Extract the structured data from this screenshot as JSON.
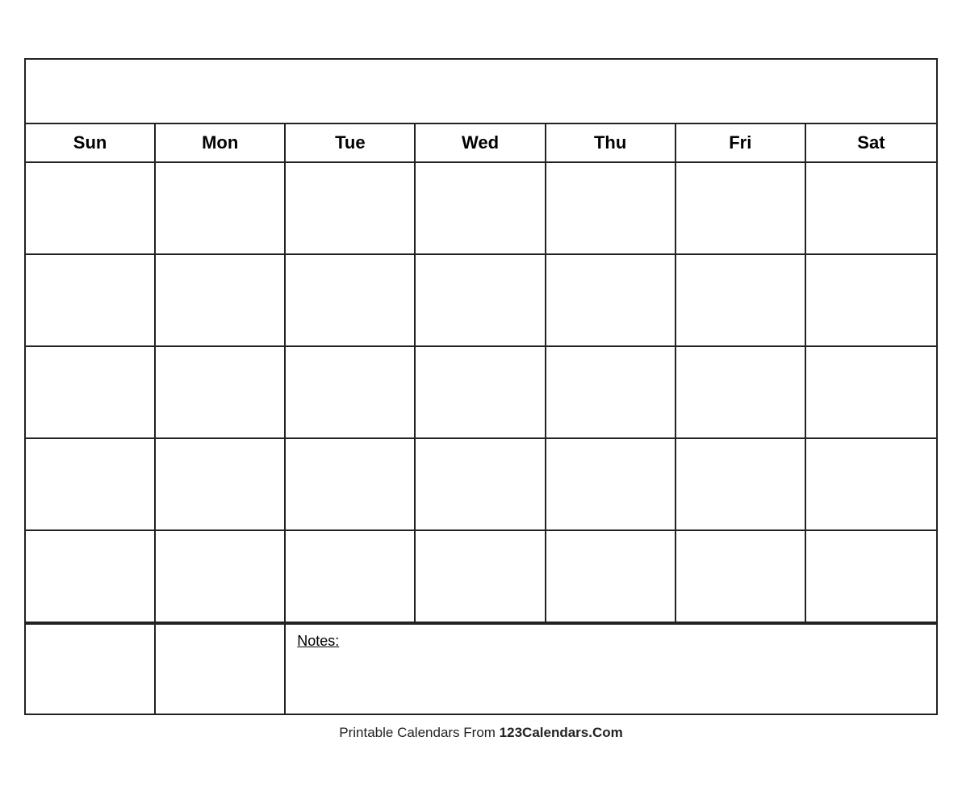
{
  "calendar": {
    "title": "",
    "days": [
      "Sun",
      "Mon",
      "Tue",
      "Wed",
      "Thu",
      "Fri",
      "Sat"
    ],
    "notes_label": "Notes:",
    "rows": 5
  },
  "footer": {
    "text_before": "Printable Calendars From ",
    "brand": "123Calendars.Com"
  }
}
